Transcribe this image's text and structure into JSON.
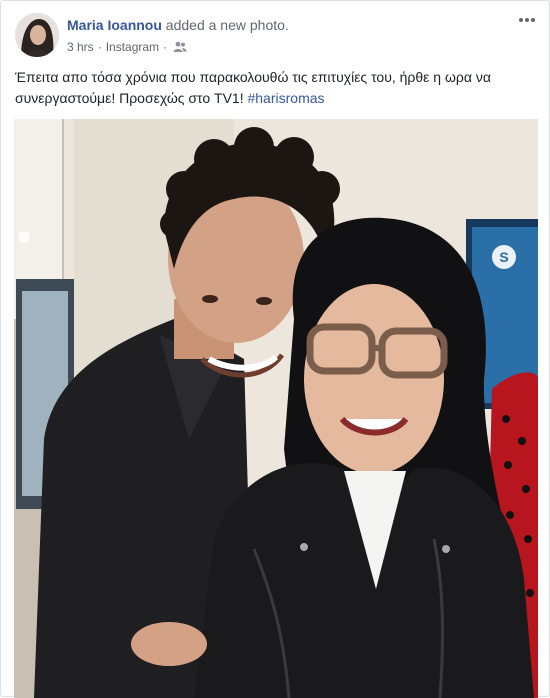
{
  "post": {
    "author": "Maria Ioannou",
    "action": "added a new photo.",
    "time": "3 hrs",
    "source": "Instagram",
    "separator": "·",
    "audience_icon": "friends-icon",
    "more_icon": "more-options-icon",
    "caption_text": "Έπειτα απο τόσα χρόνια που παρακολουθώ τις επιτυχίες του, ήρθε η ωρα να συνεργαστούμε! Προσεχώς στο TV1!",
    "hashtag": "#harisromas",
    "photo_screen_logo": "S"
  },
  "colors": {
    "link": "#365899",
    "meta": "#616770",
    "text": "#1d2129",
    "border": "#dddfe2"
  }
}
